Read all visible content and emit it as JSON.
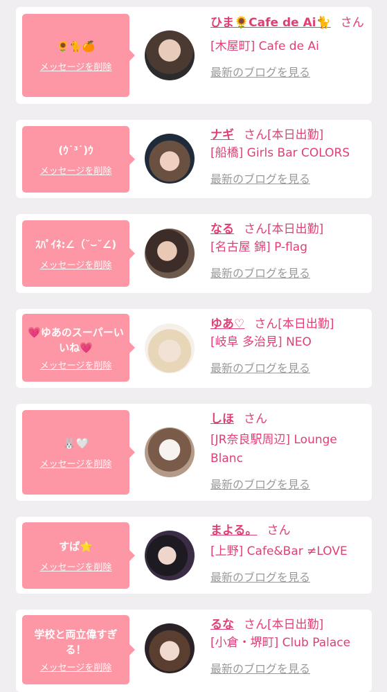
{
  "delete_label": "メッセージを削除",
  "blog_label": "最新のブログを見る",
  "honorific": "さん",
  "cards": [
    {
      "message": "🌻🐈🍊",
      "name": "ひま🌻Cafe de Ai🐈",
      "status": "",
      "shop": "[木屋町] Cafe de Ai"
    },
    {
      "message": "(ｳ˙³˙)ｳ",
      "name": "ナギ",
      "status": "[本日出勤]",
      "shop": "[船橋] Girls Bar COLORS"
    },
    {
      "message": "ｽﾊﾟｲﾈ:∠（˘⌣˘∠)",
      "name": "なる",
      "status": "[本日出勤]",
      "shop": "[名古屋 錦] P-flag"
    },
    {
      "message": "💗ゆあのスーパーいいね💗",
      "name": "ゆあ♡",
      "status": "[本日出勤]",
      "shop": "[岐阜 多治見] NEO"
    },
    {
      "message": "🐰🤍",
      "name": "しほ",
      "status": "",
      "shop": "[JR奈良駅周辺] Lounge Blanc"
    },
    {
      "message": "すぱ⭐",
      "name": "まよる。",
      "status": "",
      "shop": "[上野] Cafe&Bar ≠LOVE"
    },
    {
      "message": "学校と両立偉すぎる！",
      "name": "るな",
      "status": "[本日出勤]",
      "shop": "[小倉・堺町] Club Palace"
    }
  ]
}
